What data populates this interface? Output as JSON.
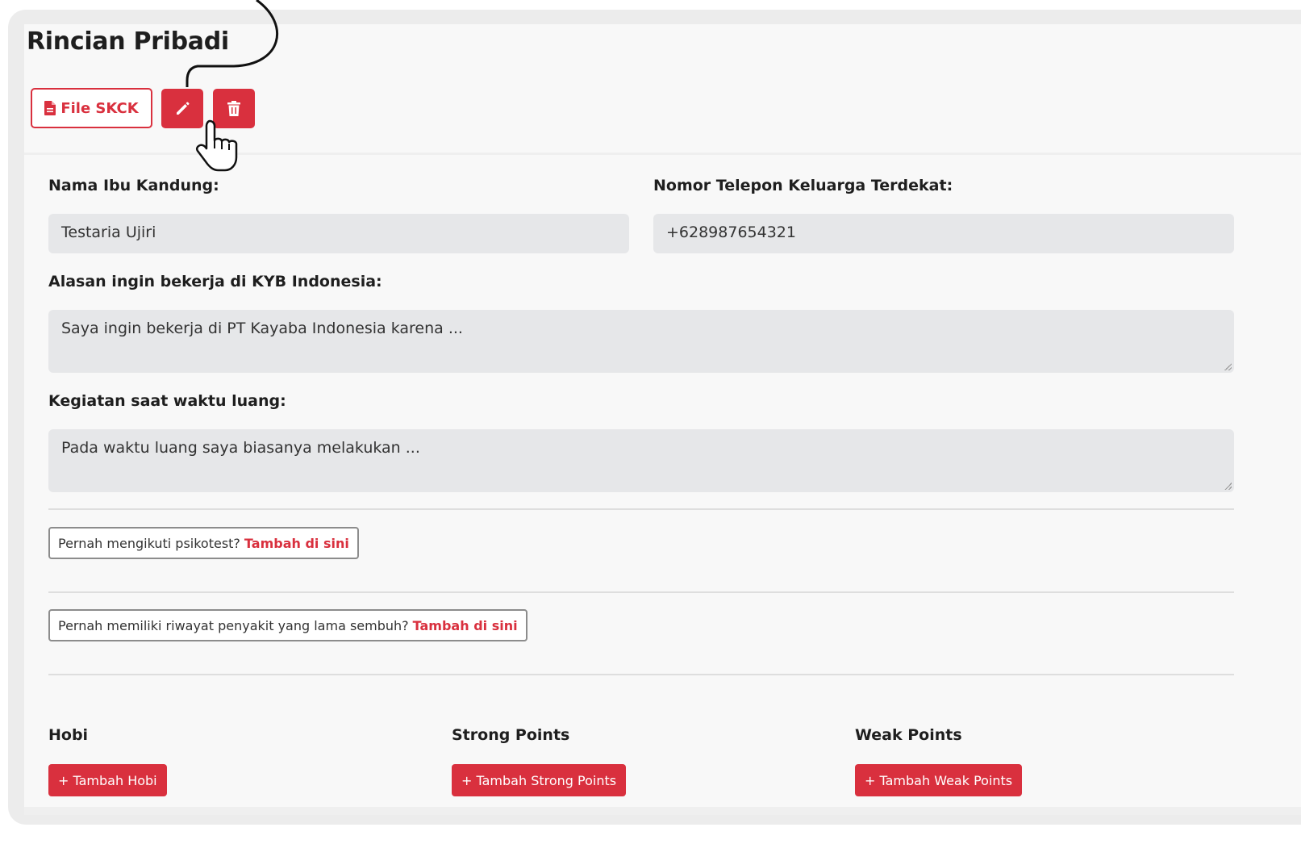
{
  "header": {
    "title": "Rincian Pribadi",
    "file_button_label": "File SKCK"
  },
  "form": {
    "mother_name": {
      "label": "Nama Ibu Kandung:",
      "value": "Testaria Ujiri"
    },
    "family_phone": {
      "label": "Nomor Telepon Keluarga Terdekat:",
      "value": "+628987654321"
    },
    "reason": {
      "label": "Alasan ingin bekerja di KYB Indonesia:",
      "value": "Saya ingin bekerja di PT Kayaba Indonesia karena ..."
    },
    "free_time": {
      "label": "Kegiatan saat waktu luang:",
      "value": "Pada waktu luang saya biasanya melakukan ..."
    }
  },
  "prompts": {
    "psikotest": {
      "text": "Pernah mengikuti psikotest?",
      "link": "Tambah di sini"
    },
    "illness": {
      "text": "Pernah memiliki riwayat penyakit yang lama sembuh?",
      "link": "Tambah di sini"
    }
  },
  "sections": {
    "hobi": {
      "title": "Hobi",
      "button": "+ Tambah Hobi"
    },
    "strong": {
      "title": "Strong Points",
      "button": "+ Tambah Strong Points"
    },
    "weak": {
      "title": "Weak Points",
      "button": "+ Tambah Weak Points"
    }
  },
  "colors": {
    "accent": "#d9303e",
    "field_bg": "#e6e7e9",
    "card_bg": "#f8f8f8"
  },
  "icons": {
    "file": "file-icon",
    "edit": "pencil-icon",
    "delete": "trash-icon",
    "cursor": "hand-pointer-icon"
  }
}
